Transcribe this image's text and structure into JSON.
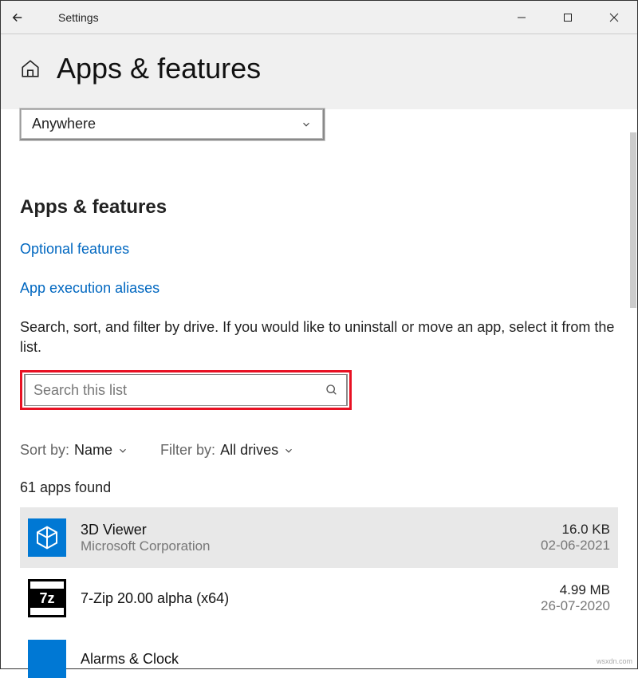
{
  "titlebar": {
    "title": "Settings"
  },
  "header": {
    "title": "Apps & features"
  },
  "installFrom": {
    "selected": "Anywhere"
  },
  "section": {
    "heading": "Apps & features",
    "link1": "Optional features",
    "link2": "App execution aliases",
    "description": "Search, sort, and filter by drive. If you would like to uninstall or move an app, select it from the list."
  },
  "search": {
    "placeholder": "Search this list"
  },
  "sort": {
    "label": "Sort by:",
    "value": "Name"
  },
  "filter": {
    "label": "Filter by:",
    "value": "All drives"
  },
  "count": "61 apps found",
  "apps": [
    {
      "name": "3D Viewer",
      "publisher": "Microsoft Corporation",
      "size": "16.0 KB",
      "date": "02-06-2021"
    },
    {
      "name": "7-Zip 20.00 alpha (x64)",
      "publisher": "",
      "size": "4.99 MB",
      "date": "26-07-2020"
    },
    {
      "name": "Alarms & Clock",
      "publisher": "",
      "size": "",
      "date": ""
    }
  ],
  "watermark": "wsxdn.com"
}
